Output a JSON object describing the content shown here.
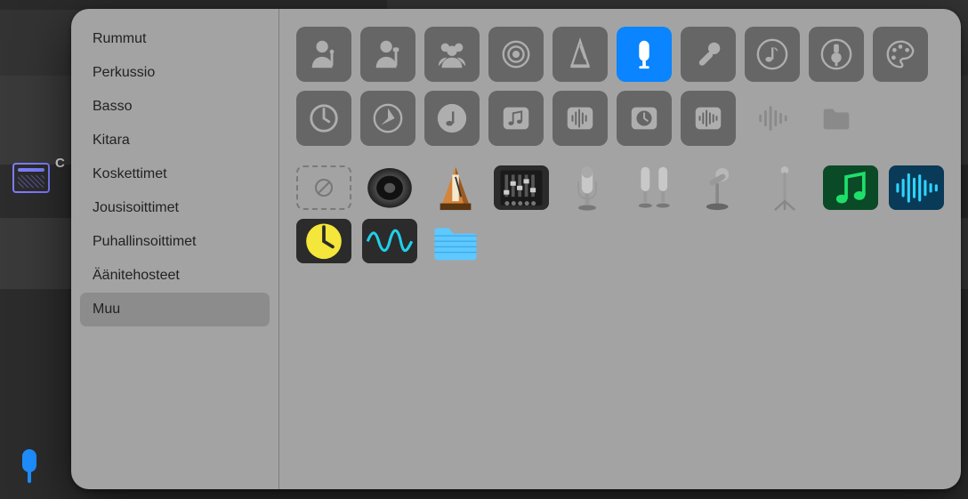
{
  "background": {
    "truncated_label": "C"
  },
  "sidebar": {
    "items": [
      {
        "label": "Rummut"
      },
      {
        "label": "Perkussio"
      },
      {
        "label": "Basso"
      },
      {
        "label": "Kitara"
      },
      {
        "label": "Koskettimet"
      },
      {
        "label": "Jousisoittimet"
      },
      {
        "label": "Puhallinsoittimet"
      },
      {
        "label": "Äänitehosteet"
      },
      {
        "label": "Muu"
      }
    ],
    "selected_index": 8
  },
  "icon_grid": {
    "row1": [
      {
        "name": "person-mic-icon"
      },
      {
        "name": "person-mic-alt-icon"
      },
      {
        "name": "group-icon"
      },
      {
        "name": "speaker-cone-icon"
      },
      {
        "name": "metronome-icon"
      },
      {
        "name": "condenser-mic-icon",
        "selected": true
      },
      {
        "name": "dynamic-mic-icon"
      },
      {
        "name": "music-note-circle-icon"
      },
      {
        "name": "plug-icon"
      },
      {
        "name": "palette-icon"
      }
    ],
    "row2": [
      {
        "name": "clock-icon"
      },
      {
        "name": "compass-icon"
      },
      {
        "name": "note-circle-icon"
      },
      {
        "name": "music-notes-tile-icon"
      },
      {
        "name": "waveform-tile-icon"
      },
      {
        "name": "clock-tile-icon"
      },
      {
        "name": "waveform-tile2-icon"
      },
      {
        "name": "waveform-lines-icon"
      },
      {
        "name": "folder-icon"
      }
    ],
    "color_row1": [
      {
        "name": "none-icon",
        "tile": "dashed"
      },
      {
        "name": "speaker-3d-icon",
        "tile": "plain"
      },
      {
        "name": "metronome-3d-icon",
        "tile": "plain"
      },
      {
        "name": "mixer-3d-icon",
        "tile": "dark"
      },
      {
        "name": "mic-3d-icon",
        "tile": "plain"
      },
      {
        "name": "dual-mic-3d-icon",
        "tile": "plain"
      },
      {
        "name": "desk-mic-3d-icon",
        "tile": "plain"
      },
      {
        "name": "mic-stand-3d-icon",
        "tile": "plain"
      },
      {
        "name": "music-green-icon",
        "tile": "green"
      },
      {
        "name": "waveform-blue-icon",
        "tile": "blue"
      }
    ],
    "color_row2": [
      {
        "name": "clock-yellow-icon",
        "tile": "yellow"
      },
      {
        "name": "waveform-cyan-icon",
        "tile": "dark"
      },
      {
        "name": "folder-blue-icon",
        "tile": "folder"
      }
    ]
  },
  "colors": {
    "accent": "#0a84ff",
    "panel": "#a3a3a3",
    "tile_default": "#666666",
    "tile_icon": "#aeaeae"
  }
}
